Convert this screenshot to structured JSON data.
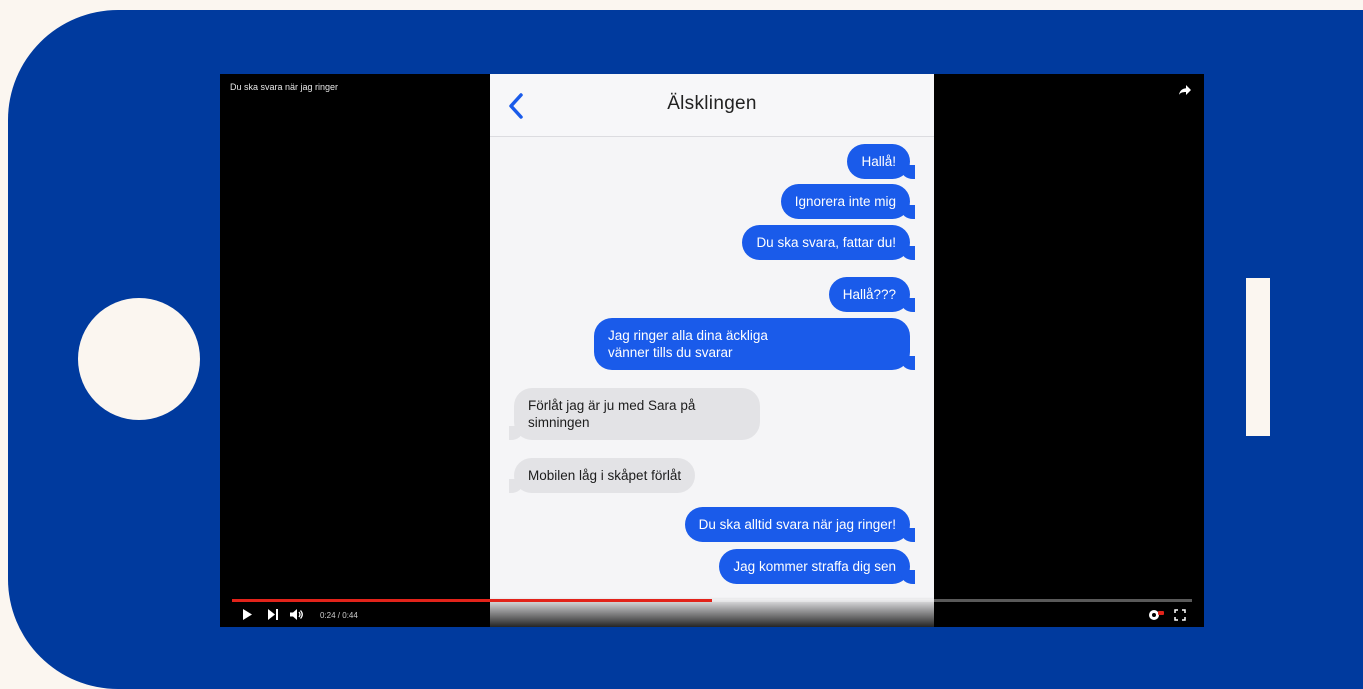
{
  "video": {
    "title": "Du ska svara när jag ringer",
    "time": "0:24 / 0:44",
    "progress": 0.5,
    "caption_hint": "",
    "colors": {
      "progress": "#e2231a",
      "phone_frame": "#003a9e"
    }
  },
  "conversation": {
    "contact_name": "Älsklingen",
    "messages": [
      {
        "dir": "out",
        "text": "Hallå!"
      },
      {
        "dir": "out",
        "text": "Ignorera inte mig"
      },
      {
        "dir": "out",
        "text": "Du ska svara, fattar du!"
      },
      {
        "dir": "out",
        "text": "Hallå???"
      },
      {
        "dir": "out",
        "line1": "Jag ringer alla dina äckliga",
        "line2": "vänner tills du svarar"
      },
      {
        "dir": "in",
        "line1": "Förlåt jag är ju med Sara på",
        "line2": "simningen"
      },
      {
        "dir": "in",
        "text": "Mobilen låg i skåpet förlåt"
      },
      {
        "dir": "out",
        "text": "Du ska alltid svara när jag ringer!"
      },
      {
        "dir": "out",
        "text": "Jag kommer straffa dig sen"
      }
    ],
    "colors": {
      "outgoing": "#1a5bea",
      "incoming": "#e3e3e6"
    }
  },
  "icons": [
    "back-chevron-icon",
    "share-icon",
    "play-icon",
    "next-icon",
    "volume-icon",
    "settings-icon",
    "fullscreen-icon"
  ]
}
